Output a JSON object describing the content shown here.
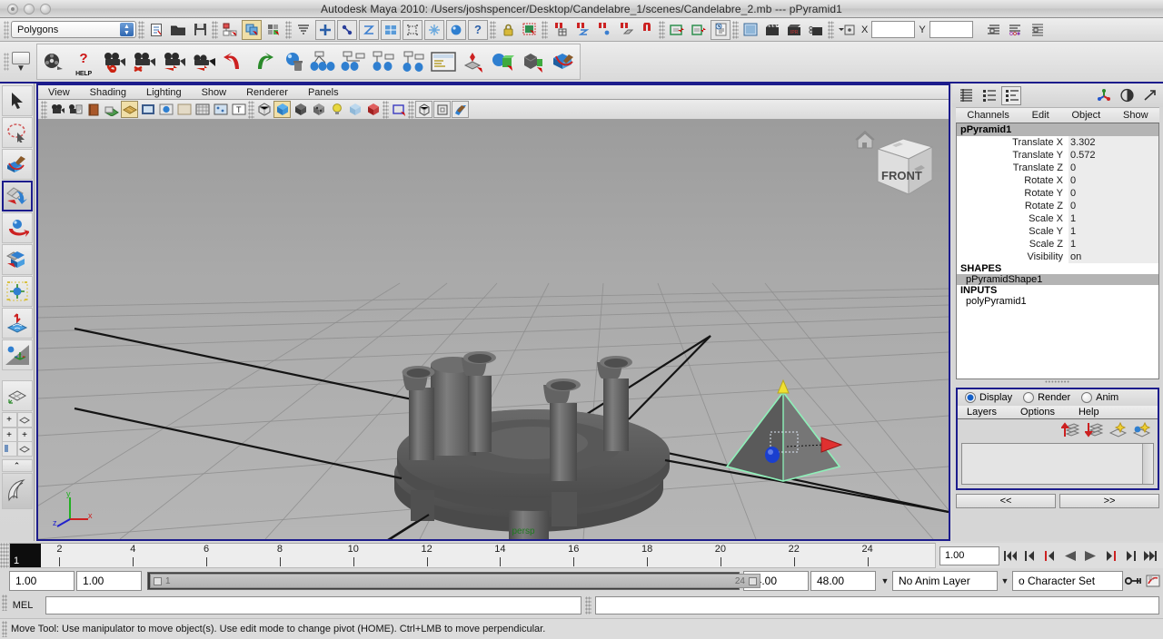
{
  "window": {
    "title": "Autodesk Maya 2010: /Users/joshspencer/Desktop/Candelabre_1/scenes/Candelabre_2.mb   ---   pPyramid1"
  },
  "status_line": {
    "menu_set": "Polygons",
    "x_label": "X",
    "y_label": "Y",
    "x_value": "",
    "y_value": "",
    "buttons": [
      {
        "name": "new-scene-icon",
        "glyph": "📄"
      },
      {
        "name": "open-scene-icon",
        "glyph": "📁"
      },
      {
        "name": "save-scene-icon",
        "glyph": "💾"
      },
      {
        "name": "select-by-hierarchy-icon",
        "glyph": "⬚"
      },
      {
        "name": "select-by-object-type-icon",
        "glyph": "⬛"
      },
      {
        "name": "select-by-component-type-icon",
        "glyph": "▦"
      },
      {
        "name": "selection-mask-icon",
        "glyph": "☰"
      },
      {
        "name": "handle-mask-icon",
        "glyph": "+"
      },
      {
        "name": "joints-mask-icon",
        "glyph": "⚯"
      },
      {
        "name": "curves-mask-icon",
        "glyph": "⌇"
      },
      {
        "name": "surfaces-mask-icon",
        "glyph": "▣"
      },
      {
        "name": "deformations-mask-icon",
        "glyph": "▢"
      },
      {
        "name": "dynamics-mask-icon",
        "glyph": "✳"
      },
      {
        "name": "rendering-mask-icon",
        "glyph": "●"
      },
      {
        "name": "misc-mask-icon",
        "glyph": "?"
      },
      {
        "name": "lock-selection-icon",
        "glyph": "🔒"
      },
      {
        "name": "highlight-selection-icon",
        "glyph": "▩"
      },
      {
        "name": "snap-to-grid-icon",
        "glyph": "🧲"
      },
      {
        "name": "snap-to-curve-icon",
        "glyph": "⌇"
      },
      {
        "name": "snap-to-point-icon",
        "glyph": "•"
      },
      {
        "name": "snap-to-plane-icon",
        "glyph": "▱"
      },
      {
        "name": "snap-to-view-plane-icon",
        "glyph": "▭"
      },
      {
        "name": "input-connections-icon",
        "glyph": "▸"
      },
      {
        "name": "output-connections-icon",
        "glyph": "▸"
      },
      {
        "name": "construction-history-icon",
        "glyph": "🕒"
      },
      {
        "name": "render-current-frame-icon",
        "glyph": "🎬"
      },
      {
        "name": "ipr-render-icon",
        "glyph": "🎥"
      },
      {
        "name": "render-settings-icon",
        "glyph": "🎬"
      },
      {
        "name": "render-globals-icon",
        "glyph": "⊙"
      },
      {
        "name": "toggle-panel-icon",
        "glyph": "⊞"
      }
    ],
    "right_icons": [
      {
        "name": "show-attribute-editor-icon",
        "glyph": "≡"
      },
      {
        "name": "show-tool-settings-icon",
        "glyph": "≔"
      },
      {
        "name": "show-channel-box-icon",
        "glyph": "≣"
      }
    ]
  },
  "shelf": {
    "tab_name": "Polygons",
    "items": [
      {
        "name": "film-reel-icon",
        "glyph": "🎦",
        "label": ""
      },
      {
        "name": "help-icon",
        "glyph": "?",
        "label": "HELP"
      },
      {
        "name": "camera-anchor-icon",
        "glyph": "🎥",
        "label": ""
      },
      {
        "name": "camera-delete-icon",
        "glyph": "🎥",
        "label": ""
      },
      {
        "name": "camera-add-icon",
        "glyph": "🎥",
        "label": ""
      },
      {
        "name": "camera-playblast-icon",
        "glyph": "🎥",
        "label": ""
      },
      {
        "name": "undo-arrow-icon",
        "glyph": "↶",
        "label": ""
      },
      {
        "name": "redo-arrow-icon",
        "glyph": "↷",
        "label": ""
      },
      {
        "name": "delete-sphere-icon",
        "glyph": "🗑",
        "label": ""
      },
      {
        "name": "hierarchy-parent-icon",
        "glyph": "⚫",
        "label": ""
      },
      {
        "name": "hierarchy-group-icon",
        "glyph": "⚫",
        "label": ""
      },
      {
        "name": "hierarchy-unparent-icon",
        "glyph": "⚫",
        "label": ""
      },
      {
        "name": "hierarchy-node-icon",
        "glyph": "⚫",
        "label": ""
      },
      {
        "name": "script-editor-icon",
        "glyph": "⌸",
        "label": ""
      },
      {
        "name": "snap-together-icon",
        "glyph": "◆",
        "label": ""
      },
      {
        "name": "boolean-union-icon",
        "glyph": "◼",
        "label": ""
      },
      {
        "name": "combine-mesh-icon",
        "glyph": "▧",
        "label": ""
      },
      {
        "name": "paint-tool-icon",
        "glyph": "🖌",
        "label": ""
      }
    ]
  },
  "toolbox": {
    "tools": [
      {
        "name": "select-tool",
        "glyph": "➤",
        "selected": false
      },
      {
        "name": "lasso-select-tool",
        "glyph": "◌",
        "selected": false
      },
      {
        "name": "paint-select-tool",
        "glyph": "🖌",
        "selected": false
      },
      {
        "name": "move-tool",
        "glyph": "✣",
        "selected": true
      },
      {
        "name": "rotate-tool",
        "glyph": "↻",
        "selected": false
      },
      {
        "name": "scale-tool",
        "glyph": "⤡",
        "selected": false
      },
      {
        "name": "universal-manipulator-tool",
        "glyph": "✲",
        "selected": false
      },
      {
        "name": "soft-modification-tool",
        "glyph": "◈",
        "selected": false
      },
      {
        "name": "show-manipulator-tool",
        "glyph": "⚙",
        "selected": false
      }
    ],
    "layouts": [
      {
        "name": "single-perspective-layout",
        "glyph": "▱"
      },
      {
        "name": "four-view-layout",
        "glyph": "⊞"
      },
      {
        "name": "outliner-persp-layout",
        "glyph": "⌸"
      },
      {
        "name": "hypergraph-layout",
        "glyph": "∧"
      },
      {
        "name": "maya-logo-icon",
        "glyph": "❦"
      }
    ]
  },
  "viewport": {
    "menus": [
      "View",
      "Shading",
      "Lighting",
      "Show",
      "Renderer",
      "Panels"
    ],
    "toolbar": [
      {
        "name": "select-camera-icon",
        "glyph": "🎥"
      },
      {
        "name": "camera-attributes-icon",
        "glyph": "📷"
      },
      {
        "name": "bookmark-icon",
        "glyph": "📕"
      },
      {
        "name": "image-plane-icon",
        "glyph": "◧"
      },
      {
        "name": "two-d-pan-zoom-icon",
        "glyph": "◈",
        "active": true
      },
      {
        "name": "grease-pencil-icon",
        "glyph": "▭"
      },
      {
        "name": "film-gate-icon",
        "glyph": "●"
      },
      {
        "name": "resolution-gate-icon",
        "glyph": "◯"
      },
      {
        "name": "gate-mask-icon",
        "glyph": "▦"
      },
      {
        "name": "field-chart-icon",
        "glyph": "✧"
      },
      {
        "name": "safe-title-icon",
        "glyph": "T"
      },
      {
        "name": "wireframe-shading-icon",
        "glyph": "⬡"
      },
      {
        "name": "smooth-shade-all-icon",
        "glyph": "⬛",
        "active": true
      },
      {
        "name": "smooth-shade-selected-icon",
        "glyph": "⬛"
      },
      {
        "name": "flat-shade-icon",
        "glyph": "⬛"
      },
      {
        "name": "use-default-lighting-icon",
        "glyph": "💡"
      },
      {
        "name": "shadows-icon",
        "glyph": "⬜"
      },
      {
        "name": "hardware-texturing-icon",
        "glyph": "⬛"
      },
      {
        "name": "xray-mode-icon",
        "glyph": "▫"
      },
      {
        "name": "isolate-select-icon",
        "glyph": "⬡"
      },
      {
        "name": "view-bounding-box-icon",
        "glyph": "▣"
      },
      {
        "name": "paint-effects-icon",
        "glyph": "🖌"
      }
    ],
    "camera_label": "persp",
    "axis_labels": {
      "x": "x",
      "y": "y",
      "z": "z"
    },
    "view_cube_face": "FRONT",
    "home_icon": "home-icon"
  },
  "channel_box": {
    "header_icons": [
      {
        "name": "channel-box-list-icon",
        "glyph": "≣"
      },
      {
        "name": "channel-box-layers-icon",
        "glyph": "☷"
      },
      {
        "name": "channel-box-combined-icon",
        "glyph": "≡",
        "selected": true
      },
      {
        "name": "attribute-editor-icon",
        "glyph": "✦"
      },
      {
        "name": "tool-settings-icon",
        "glyph": "◑"
      },
      {
        "name": "channel-box-arrow-icon",
        "glyph": "↗"
      }
    ],
    "menus": [
      "Channels",
      "Edit",
      "Object",
      "Show"
    ],
    "object_name": "pPyramid1",
    "channels": [
      {
        "key": "Translate X",
        "value": "3.302"
      },
      {
        "key": "Translate Y",
        "value": "0.572"
      },
      {
        "key": "Translate Z",
        "value": "0"
      },
      {
        "key": "Rotate X",
        "value": "0"
      },
      {
        "key": "Rotate Y",
        "value": "0"
      },
      {
        "key": "Rotate Z",
        "value": "0"
      },
      {
        "key": "Scale X",
        "value": "1"
      },
      {
        "key": "Scale Y",
        "value": "1"
      },
      {
        "key": "Scale Z",
        "value": "1"
      },
      {
        "key": "Visibility",
        "value": "on"
      }
    ],
    "shapes_label": "SHAPES",
    "shape_item": "pPyramidShape1",
    "inputs_label": "INPUTS",
    "input_item": "polyPyramid1"
  },
  "layer_editor": {
    "modes": [
      {
        "label": "Display",
        "selected": true
      },
      {
        "label": "Render",
        "selected": false
      },
      {
        "label": "Anim",
        "selected": false
      }
    ],
    "menus": [
      "Layers",
      "Options",
      "Help"
    ],
    "tools": [
      {
        "name": "move-layer-up-icon",
        "glyph": "⬆"
      },
      {
        "name": "move-layer-down-icon",
        "glyph": "⬇"
      },
      {
        "name": "new-layer-icon",
        "glyph": "✧"
      },
      {
        "name": "new-layer-from-selected-icon",
        "glyph": "✦"
      }
    ],
    "prev_label": "<<",
    "next_label": ">>"
  },
  "time_slider": {
    "tick_labels": [
      "2",
      "4",
      "6",
      "8",
      "10",
      "12",
      "14",
      "16",
      "18",
      "20",
      "22",
      "24"
    ],
    "current_frame_marker": "1",
    "current_frame_field": "1.00",
    "playback_buttons": [
      {
        "name": "go-to-start-button",
        "glyph": "⏮"
      },
      {
        "name": "step-back-keyframe-button",
        "glyph": "⏴"
      },
      {
        "name": "step-back-frame-button",
        "glyph": "◀"
      },
      {
        "name": "play-backwards-button",
        "glyph": "◀"
      },
      {
        "name": "play-forwards-button",
        "glyph": "▶"
      },
      {
        "name": "step-forward-frame-button",
        "glyph": "▶"
      },
      {
        "name": "step-forward-keyframe-button",
        "glyph": "⏵"
      },
      {
        "name": "go-to-end-button",
        "glyph": "⏭"
      }
    ]
  },
  "range_slider": {
    "anim_start": "1.00",
    "range_start": "1.00",
    "bar_start_label": "1",
    "bar_end_label": "24",
    "range_end": "24.00",
    "anim_end": "48.00",
    "anim_layer": "No Anim Layer",
    "character_set": "o Character Set",
    "icons": [
      {
        "name": "auto-keyframe-icon",
        "glyph": "⚷"
      },
      {
        "name": "animation-preferences-icon",
        "glyph": "⚙"
      }
    ]
  },
  "command_line": {
    "label": "MEL",
    "input_value": "",
    "result_value": ""
  },
  "help_line": {
    "message": "Move Tool: Use manipulator to move object(s). Use edit mode to change pivot (HOME).  Ctrl+LMB to move perpendicular."
  }
}
